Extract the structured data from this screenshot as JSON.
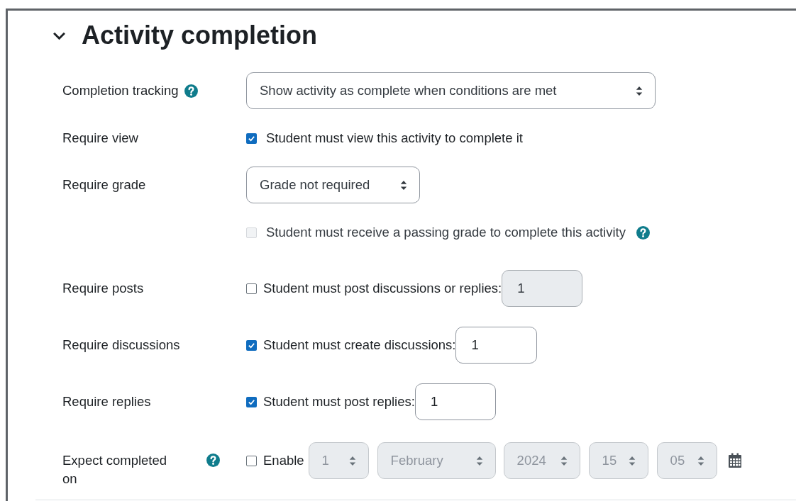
{
  "section": {
    "title": "Activity completion",
    "expanded": true
  },
  "rows": [
    {
      "kind": "select",
      "label": "Completion tracking",
      "help": true,
      "value": "Show activity as complete when conditions are met"
    },
    {
      "kind": "checkbox",
      "label": "Require view",
      "help": false,
      "checked": true,
      "disabled": false,
      "text": "Student must view this activity to complete it"
    },
    {
      "kind": "select",
      "label": "Require grade",
      "help": false,
      "value": "Grade not required"
    },
    {
      "kind": "checkbox",
      "help": true,
      "checked": false,
      "disabled": true,
      "text": "Student must receive a passing grade to complete this activity"
    },
    {
      "kind": "number",
      "label": "Require posts",
      "help": false,
      "checked": false,
      "text": "Student must post discussions or replies:",
      "value": "1"
    },
    {
      "kind": "number",
      "label": "Require discussions",
      "help": false,
      "checked": true,
      "text": "Student must create discussions:",
      "value": "1"
    },
    {
      "kind": "number",
      "label": "Require replies",
      "help": false,
      "checked": true,
      "text": "Student must post replies:",
      "value": "1"
    },
    {
      "kind": "date",
      "label": "Expect completed on",
      "help": true,
      "checked": false,
      "text": "Enable",
      "fields": [
        "1",
        "February",
        "2024",
        "15",
        "05"
      ]
    }
  ]
}
